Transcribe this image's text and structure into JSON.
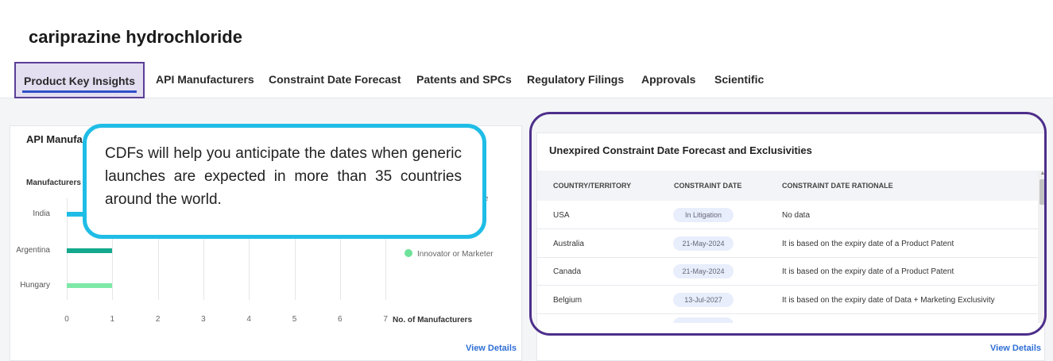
{
  "page": {
    "title": "cariprazine hydrochloride",
    "tabs": [
      {
        "label": "Product Key Insights",
        "active": true
      },
      {
        "label": "API Manufacturers"
      },
      {
        "label": "Constraint Date Forecast"
      },
      {
        "label": "Patents and SPCs"
      },
      {
        "label": "Regulatory Filings"
      },
      {
        "label": "Approvals"
      },
      {
        "label": "Scientific"
      }
    ]
  },
  "left_card": {
    "title": "API Manufa",
    "y_header": "Manufacturers",
    "legend_partial": "ble",
    "legend": [
      {
        "label": "Innovator or Marketer",
        "color": "#6ee29a"
      }
    ],
    "view_details": "View Details"
  },
  "chart_data": {
    "type": "bar",
    "orientation": "horizontal",
    "categories": [
      "India",
      "Argentina",
      "Hungary"
    ],
    "values": [
      1,
      1,
      1
    ],
    "colors": [
      "#1fbde6",
      "#14a88c",
      "#7ee8a8"
    ],
    "xlabel": "No. of Manufacturers",
    "xlim": [
      0,
      7
    ],
    "xticks": [
      "0",
      "1",
      "2",
      "3",
      "4",
      "5",
      "6",
      "7"
    ],
    "grid": true
  },
  "callout": {
    "text": "CDFs will help you anticipate the dates when generic launches are expected in more than 35 countries around the world."
  },
  "right_card": {
    "title": "Unexpired Constraint Date Forecast and Exclusivities",
    "columns": [
      "COUNTRY/TERRITORY",
      "CONSTRAINT DATE",
      "CONSTRAINT DATE RATIONALE"
    ],
    "rows": [
      {
        "country": "USA",
        "date": "In Litigation",
        "rationale": "No data"
      },
      {
        "country": "Australia",
        "date": "21-May-2024",
        "rationale": "It is based on the expiry date of a Product Patent"
      },
      {
        "country": "Canada",
        "date": "21-May-2024",
        "rationale": "It is based on the expiry date of a Product Patent"
      },
      {
        "country": "Belgium",
        "date": "13-Jul-2027",
        "rationale": "It is based on the expiry date of Data + Marketing Exclusivity"
      }
    ],
    "view_details": "View Details",
    "colors": {
      "frame": "#4c2e8a",
      "callout_border": "#1fbde6",
      "link": "#2f6fd6",
      "tab_highlight": "#e4def1"
    }
  }
}
